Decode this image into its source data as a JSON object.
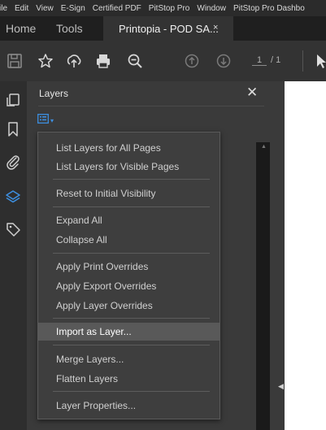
{
  "menubar": [
    "ile",
    "Edit",
    "View",
    "E-Sign",
    "Certified PDF",
    "PitStop Pro",
    "Window",
    "PitStop Pro Dashbo"
  ],
  "tabs": {
    "home": "Home",
    "tools": "Tools",
    "document": "Printopia - POD SA...",
    "close": "×"
  },
  "toolbar": {
    "icons": [
      "save-icon",
      "bookmark-star-icon",
      "share-upload-icon",
      "print-icon",
      "zoom-out-icon",
      "page-up-icon",
      "page-down-icon",
      "select-cursor-icon"
    ],
    "page_current": "1",
    "page_total": "/ 1"
  },
  "left_rail": {
    "icons": [
      "copy-pages-icon",
      "bookmark-icon",
      "attachment-icon",
      "layers-icon",
      "tag-icon"
    ],
    "active": "layers-icon"
  },
  "panel": {
    "title": "Layers",
    "close": "✕",
    "options_caret": "▾"
  },
  "menu": {
    "items": [
      {
        "label": "List Layers for All Pages",
        "highlighted": false
      },
      {
        "label": "List Layers for Visible Pages",
        "highlighted": false
      },
      {
        "label": "Reset to Initial Visibility",
        "highlighted": false
      },
      {
        "label": "Expand All",
        "highlighted": false
      },
      {
        "label": "Collapse All",
        "highlighted": false
      },
      {
        "label": "Apply Print Overrides",
        "highlighted": false
      },
      {
        "label": "Apply Export Overrides",
        "highlighted": false
      },
      {
        "label": "Apply Layer Overrides",
        "highlighted": false
      },
      {
        "label": "Import as Layer...",
        "highlighted": true
      },
      {
        "label": "Merge Layers...",
        "highlighted": false
      },
      {
        "label": "Flatten Layers",
        "highlighted": false
      },
      {
        "label": "Layer Properties...",
        "highlighted": false
      }
    ]
  },
  "scroll": {
    "up_arrow": "▲",
    "collapse_arrow": "◀"
  },
  "colors": {
    "accent_blue": "#3d8fe0",
    "highlight": "#595959"
  }
}
